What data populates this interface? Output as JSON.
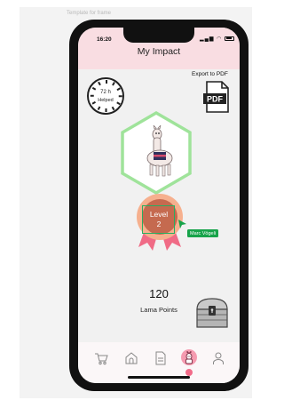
{
  "frame": {
    "label": "Template for frame"
  },
  "status_bar": {
    "time": "16:20"
  },
  "header": {
    "title": "My Impact"
  },
  "clock_widget": {
    "hours": "72 h",
    "label": "Helped"
  },
  "export": {
    "label": "Export to PDF",
    "icon_text": "PDF"
  },
  "avatar": {
    "icon": "llama-icon"
  },
  "level": {
    "label": "Level",
    "number": "2"
  },
  "collaborator": {
    "name": "Marc Vögeli"
  },
  "points": {
    "value": "120",
    "label": "Lama Points"
  },
  "tabbar": {
    "items": [
      "cart-icon",
      "home-icon",
      "document-icon",
      "llama-icon",
      "person-icon"
    ],
    "active_index": 3
  },
  "colors": {
    "header_bg": "#f9dde2",
    "hex_border": "#9fe39a",
    "badge": "#c56a4f",
    "ribbon": "#f06b86",
    "accent_pink": "#f26b89",
    "name_tag": "#17a34a"
  }
}
